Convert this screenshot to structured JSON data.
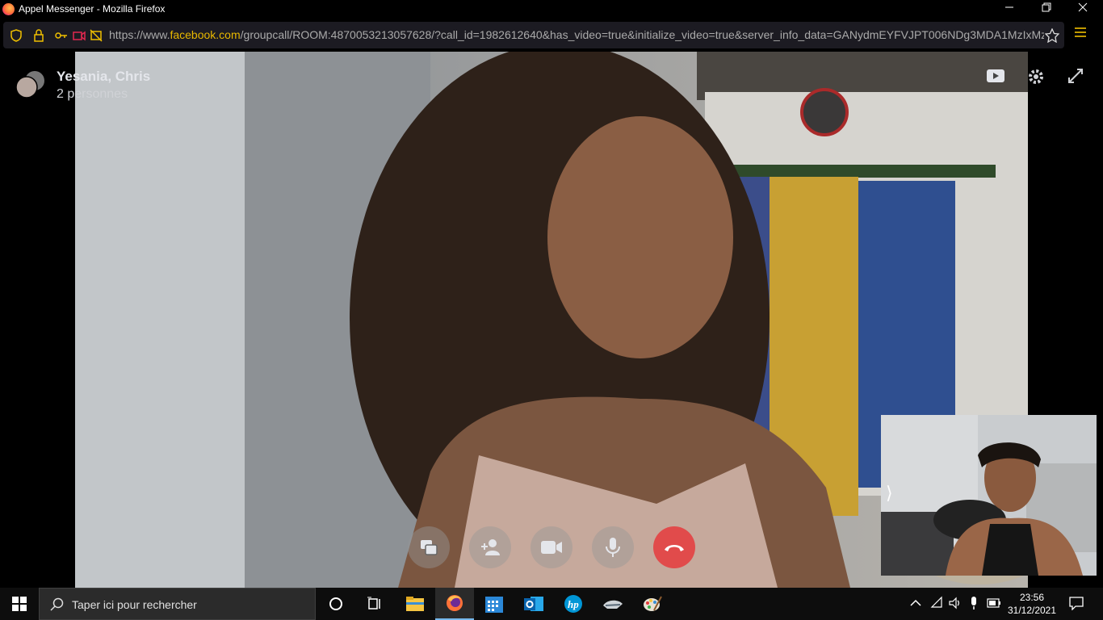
{
  "window": {
    "title": "Appel Messenger - Mozilla Firefox",
    "controls": [
      "minimize-icon",
      "restore-icon",
      "close-icon"
    ]
  },
  "navbar": {
    "url_prefix": "https://www.",
    "url_domain": "facebook.com",
    "url_rest": "/groupcall/ROOM:4870053213057628/?call_id=1982612640&has_video=true&initialize_video=true&server_info_data=GANydmEYFVJPT006NDg3MDA1MzIxMz",
    "icons": [
      "shield-icon",
      "lock-icon",
      "permissions-icon",
      "camera-sharing-icon",
      "mic-off-icon",
      "bookmark-star-icon",
      "hamburger-menu-icon"
    ]
  },
  "call": {
    "participants_name": "Yesania, Chris",
    "participants_count": "2 personnes",
    "top_icons": [
      "video-icon",
      "settings-gear-icon",
      "fullscreen-icon"
    ],
    "controls": [
      {
        "name": "share-screen-button",
        "icon": "screen-share-icon"
      },
      {
        "name": "add-person-button",
        "icon": "add-person-icon"
      },
      {
        "name": "camera-button",
        "icon": "video-camera-icon"
      },
      {
        "name": "microphone-button",
        "icon": "microphone-icon"
      },
      {
        "name": "end-call-button",
        "icon": "hang-up-icon",
        "color": "#e14b4b"
      }
    ],
    "selfview_expand": "⟩"
  },
  "taskbar": {
    "search_placeholder": "Taper ici pour rechercher",
    "apps": [
      "cortana-icon",
      "task-view-icon",
      "file-explorer-icon",
      "firefox-icon",
      "calendar-app-icon",
      "outlook-icon",
      "hp-icon",
      "app-icon",
      "paint-icon"
    ],
    "time": "23:56",
    "date": "31/12/2021",
    "tray": [
      "chevron-up-icon",
      "wifi-icon",
      "volume-icon",
      "microphone-icon",
      "battery-icon",
      "notification-icon"
    ]
  },
  "colors": {
    "accent": "#e8b800",
    "end_call": "#e14b4b",
    "taskbar": "#0d0d0d"
  }
}
